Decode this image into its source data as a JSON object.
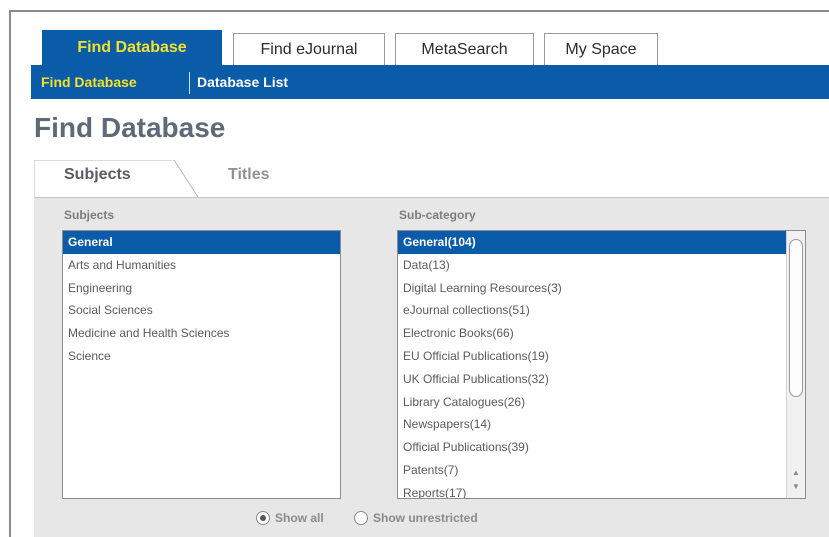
{
  "top_tabs": [
    {
      "label": "Find Database",
      "active": true
    },
    {
      "label": "Find eJournal",
      "active": false
    },
    {
      "label": "MetaSearch",
      "active": false
    },
    {
      "label": "My Space",
      "active": false
    }
  ],
  "subnav": {
    "active": "Find Database",
    "second": "Database List"
  },
  "page_title": "Find Database",
  "sub_tabs": [
    {
      "label": "Subjects",
      "active": true
    },
    {
      "label": "Titles",
      "active": false
    }
  ],
  "subjects": {
    "label": "Subjects",
    "items": [
      "General",
      "Arts and Humanities",
      "Engineering",
      "Social Sciences",
      "Medicine and Health Sciences",
      "Science"
    ],
    "selected_index": 0
  },
  "sub_category": {
    "label": "Sub-category",
    "items": [
      "General(104)",
      "Data(13)",
      "Digital Learning Resources(3)",
      "eJournal collections(51)",
      "Electronic Books(66)",
      "EU Official Publications(19)",
      "UK Official Publications(32)",
      "Library Catalogues(26)",
      "Newspapers(14)",
      "Official Publications(39)",
      "Patents(7)",
      "Reports(17)"
    ],
    "selected_index": 0
  },
  "filters": {
    "show_all": "Show all",
    "show_unrestricted": "Show unrestricted",
    "selected": "show_all"
  },
  "colors": {
    "brand_blue": "#0a5ba8",
    "active_tab_text": "#f2e22a",
    "title_gray": "#5e6a78"
  }
}
